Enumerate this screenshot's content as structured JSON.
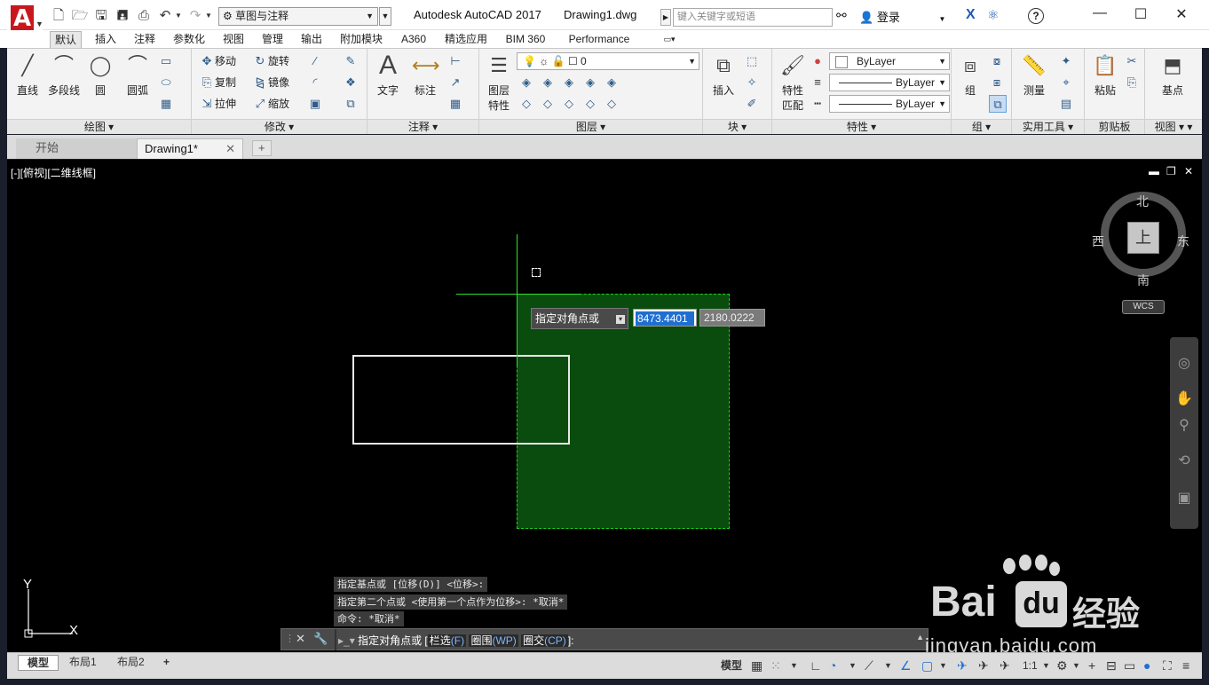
{
  "titlebar": {
    "app_title": "Autodesk AutoCAD 2017",
    "doc_title": "Drawing1.dwg",
    "workspace": "草图与注释",
    "search_placeholder": "键入关键字或短语",
    "login": "登录",
    "help": "?"
  },
  "menu_tabs": [
    "默认",
    "插入",
    "注释",
    "参数化",
    "视图",
    "管理",
    "输出",
    "附加模块",
    "A360",
    "精选应用",
    "BIM 360",
    "Performance"
  ],
  "ribbon": {
    "draw": {
      "label": "绘图",
      "line": "直线",
      "polyline": "多段线",
      "circle": "圆",
      "arc": "圆弧"
    },
    "modify": {
      "label": "修改",
      "move": "移动",
      "rotate": "旋转",
      "copy": "复制",
      "mirror": "镜像",
      "stretch": "拉伸",
      "scale": "缩放"
    },
    "annotation": {
      "label": "注释",
      "text": "文字",
      "dimension": "标注"
    },
    "layers": {
      "label": "图层",
      "layer_props_1": "图层",
      "layer_props_2": "特性",
      "current_layer": "0"
    },
    "block": {
      "label": "块",
      "insert": "插入"
    },
    "properties": {
      "label": "特性",
      "match_1": "特性",
      "match_2": "匹配",
      "color": "ByLayer",
      "linetype": "ByLayer",
      "lineweight": "ByLayer"
    },
    "groups": {
      "label": "组",
      "group": "组"
    },
    "utilities": {
      "label": "实用工具",
      "measure": "测量"
    },
    "clipboard": {
      "label": "剪贴板",
      "paste": "粘贴"
    },
    "view": {
      "label": "视图",
      "base": "基点"
    }
  },
  "doc_tabs": {
    "start": "开始",
    "drawing": "Drawing1*"
  },
  "viewport": {
    "label": "[-][俯视][二维线框]",
    "viewcube": {
      "top": "上",
      "north": "北",
      "south": "南",
      "east": "东",
      "west": "西"
    },
    "wcs": "WCS",
    "dynamic_input": {
      "prompt": "指定对角点或",
      "x_value": "8473.4401",
      "y_value": "2180.0222"
    },
    "ucs": {
      "x": "X",
      "y": "Y"
    }
  },
  "command": {
    "history": [
      "指定基点或 [位移(D)] <位移>:",
      "指定第二个点或 <使用第一个点作为位移>:  *取消*",
      "命令: *取消*"
    ],
    "prompt": "指定对角点或 [",
    "opt1_label": "栏选",
    "opt1_key": "(F)",
    "opt2_label": "圈围",
    "opt2_key": "(WP)",
    "opt3_label": "圈交",
    "opt3_key": "(CP)",
    "prompt_end": "]:"
  },
  "layout_tabs": [
    "模型",
    "布局1",
    "布局2"
  ],
  "status": {
    "model": "模型",
    "scale": "1:1"
  },
  "watermark": {
    "brand": "Bai",
    "du": "du",
    "cn": "经验",
    "url": "jingyan.baidu.com"
  }
}
